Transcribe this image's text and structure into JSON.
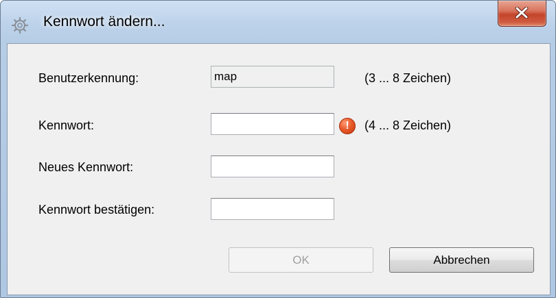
{
  "window": {
    "title": "Kennwort ändern...",
    "icon": "gear-lock-icon",
    "close_icon": "close-x-icon",
    "accent_color": "#c4452b"
  },
  "form": {
    "user_label": "Benutzerkennung:",
    "user_value": "map",
    "user_hint": "(3 ... 8 Zeichen)",
    "password_label": "Kennwort:",
    "password_value": "",
    "password_hint": "(4 ... 8 Zeichen)",
    "password_error_icon": "error-exclamation-icon",
    "new_password_label": "Neues Kennwort:",
    "new_password_value": "",
    "confirm_password_label": "Kennwort bestätigen:",
    "confirm_password_value": ""
  },
  "buttons": {
    "ok_label": "OK",
    "cancel_label": "Abbrechen"
  }
}
